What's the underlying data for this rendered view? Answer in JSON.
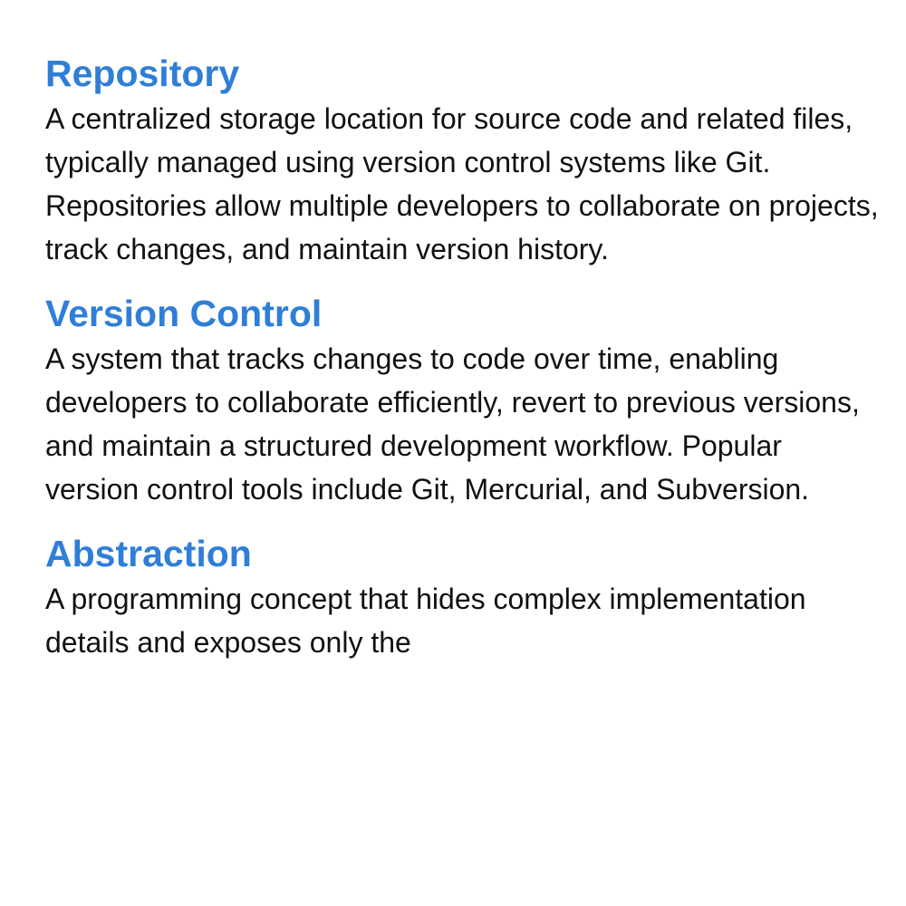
{
  "colors": {
    "term": "#2f7ed8",
    "body_text": "#111111",
    "background": "#ffffff"
  },
  "glossary": {
    "entries": [
      {
        "term": "Repository",
        "definition": "A centralized storage location for source code and related files, typically managed using version control systems like Git. Repositories allow multiple developers to collaborate on projects, track changes, and maintain version history."
      },
      {
        "term": "Version Control",
        "definition": "A system that tracks changes to code over time, enabling developers to collaborate efficiently, revert to previous versions, and maintain a structured development workflow. Popular version control tools include Git, Mercurial, and Subversion."
      },
      {
        "term": "Abstraction",
        "definition": "A programming concept that hides complex implementation details and exposes only the"
      }
    ]
  }
}
